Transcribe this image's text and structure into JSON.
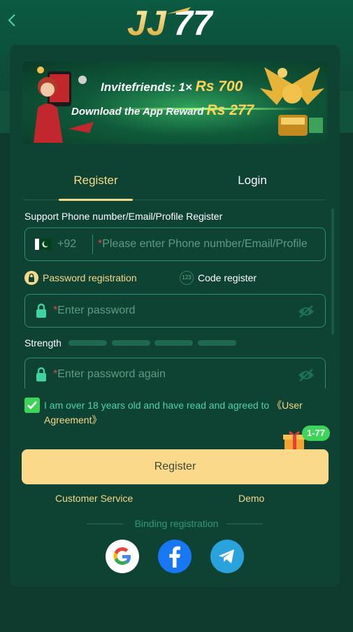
{
  "header": {
    "logo_text": "JJ77"
  },
  "banner": {
    "line1_prefix": "Invitefriends: 1×",
    "line1_amount": "Rs 700",
    "line2_prefix": "Download the App Reward",
    "line2_amount": "Rs 277"
  },
  "tabs": [
    {
      "label": "Register",
      "active": true
    },
    {
      "label": "Login",
      "active": false
    }
  ],
  "form": {
    "support_label": "Support Phone number/Email/Profile Register",
    "country_code": "+92",
    "phone_placeholder": "Please enter Phone number/Email/Profile",
    "password_registration_label": "Password registration",
    "code_register_label": "Code register",
    "code_icon_text": "123",
    "password_placeholder": "Enter password",
    "strength_label": "Strength",
    "password_again_placeholder": "Enter password again",
    "agree_text": "I am over 18 years old and have read and agreed to ",
    "agree_link": "《User Agreement》",
    "agreed": true
  },
  "gift_badge": "1-77",
  "register_button": "Register",
  "footer": {
    "customer_service": "Customer Service",
    "demo": "Demo",
    "binding_registration": "Binding registration"
  },
  "social": [
    "google-icon",
    "facebook-icon",
    "telegram-icon"
  ],
  "colors": {
    "accent_gold": "#f5d98a",
    "accent_green": "#4fd2a6",
    "button_bg": "#fbd98b",
    "card_bg": "#0e4333"
  }
}
